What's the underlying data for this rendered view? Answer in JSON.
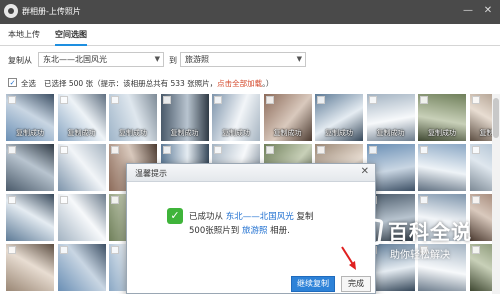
{
  "window": {
    "title": "群相册-上传照片",
    "controls": {
      "minimize": "—",
      "close": "✕"
    }
  },
  "tabs": [
    {
      "label": "本地上传",
      "active": false
    },
    {
      "label": "空间选图",
      "active": true
    }
  ],
  "copy": {
    "from_label": "复制从",
    "from_value": "东北——北国风光",
    "to_label": "到",
    "to_value": "旅游照"
  },
  "selection": {
    "select_all_label": "全选",
    "status": "已选择 500 张（提示：该相册总共有 533 张照片，",
    "load_all_link": "点击全部加载",
    "status_end": "。）"
  },
  "photos": {
    "success_label": "复制成功"
  },
  "dialog": {
    "title": "温馨提示",
    "close": "✕",
    "message_prefix": "已成功从",
    "source_album": "东北——北国风光",
    "message_middle": "复制",
    "message_line2_prefix": "500张照片到",
    "target_album": "旅游照",
    "message_line2_suffix": "相册.",
    "continue_button": "继续复制",
    "done_button": "完成"
  },
  "watermark": {
    "title": "百科全说",
    "subtitle": "助你轻松解决"
  },
  "colors": {
    "accent": "#1e8fe0",
    "link": "#d4472a",
    "primary_button": "#2d82d8",
    "success_icon": "#3fb43a"
  }
}
